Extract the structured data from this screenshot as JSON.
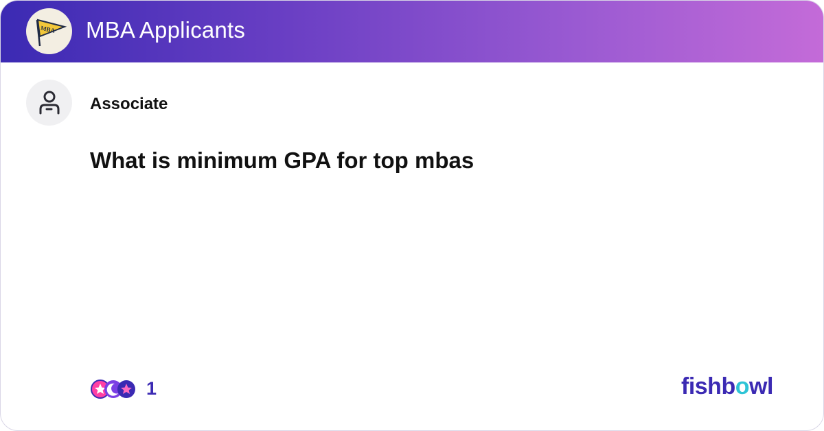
{
  "group": {
    "name": "MBA Applicants",
    "logo_text": "MBA"
  },
  "post": {
    "author": "Associate",
    "title": "What is minimum GPA for top mbas"
  },
  "reactions": {
    "count": "1",
    "icons": [
      "star-reaction-icon",
      "moon-reaction-icon",
      "star-badge-icon"
    ]
  },
  "brand": {
    "before": "fishb",
    "accent": "o",
    "after": "wl"
  },
  "colors": {
    "header_gradient_start": "#3b2ab3",
    "header_gradient_end": "#c46bd8",
    "brand_primary": "#3b2ab3",
    "brand_accent": "#2ec4d6"
  }
}
